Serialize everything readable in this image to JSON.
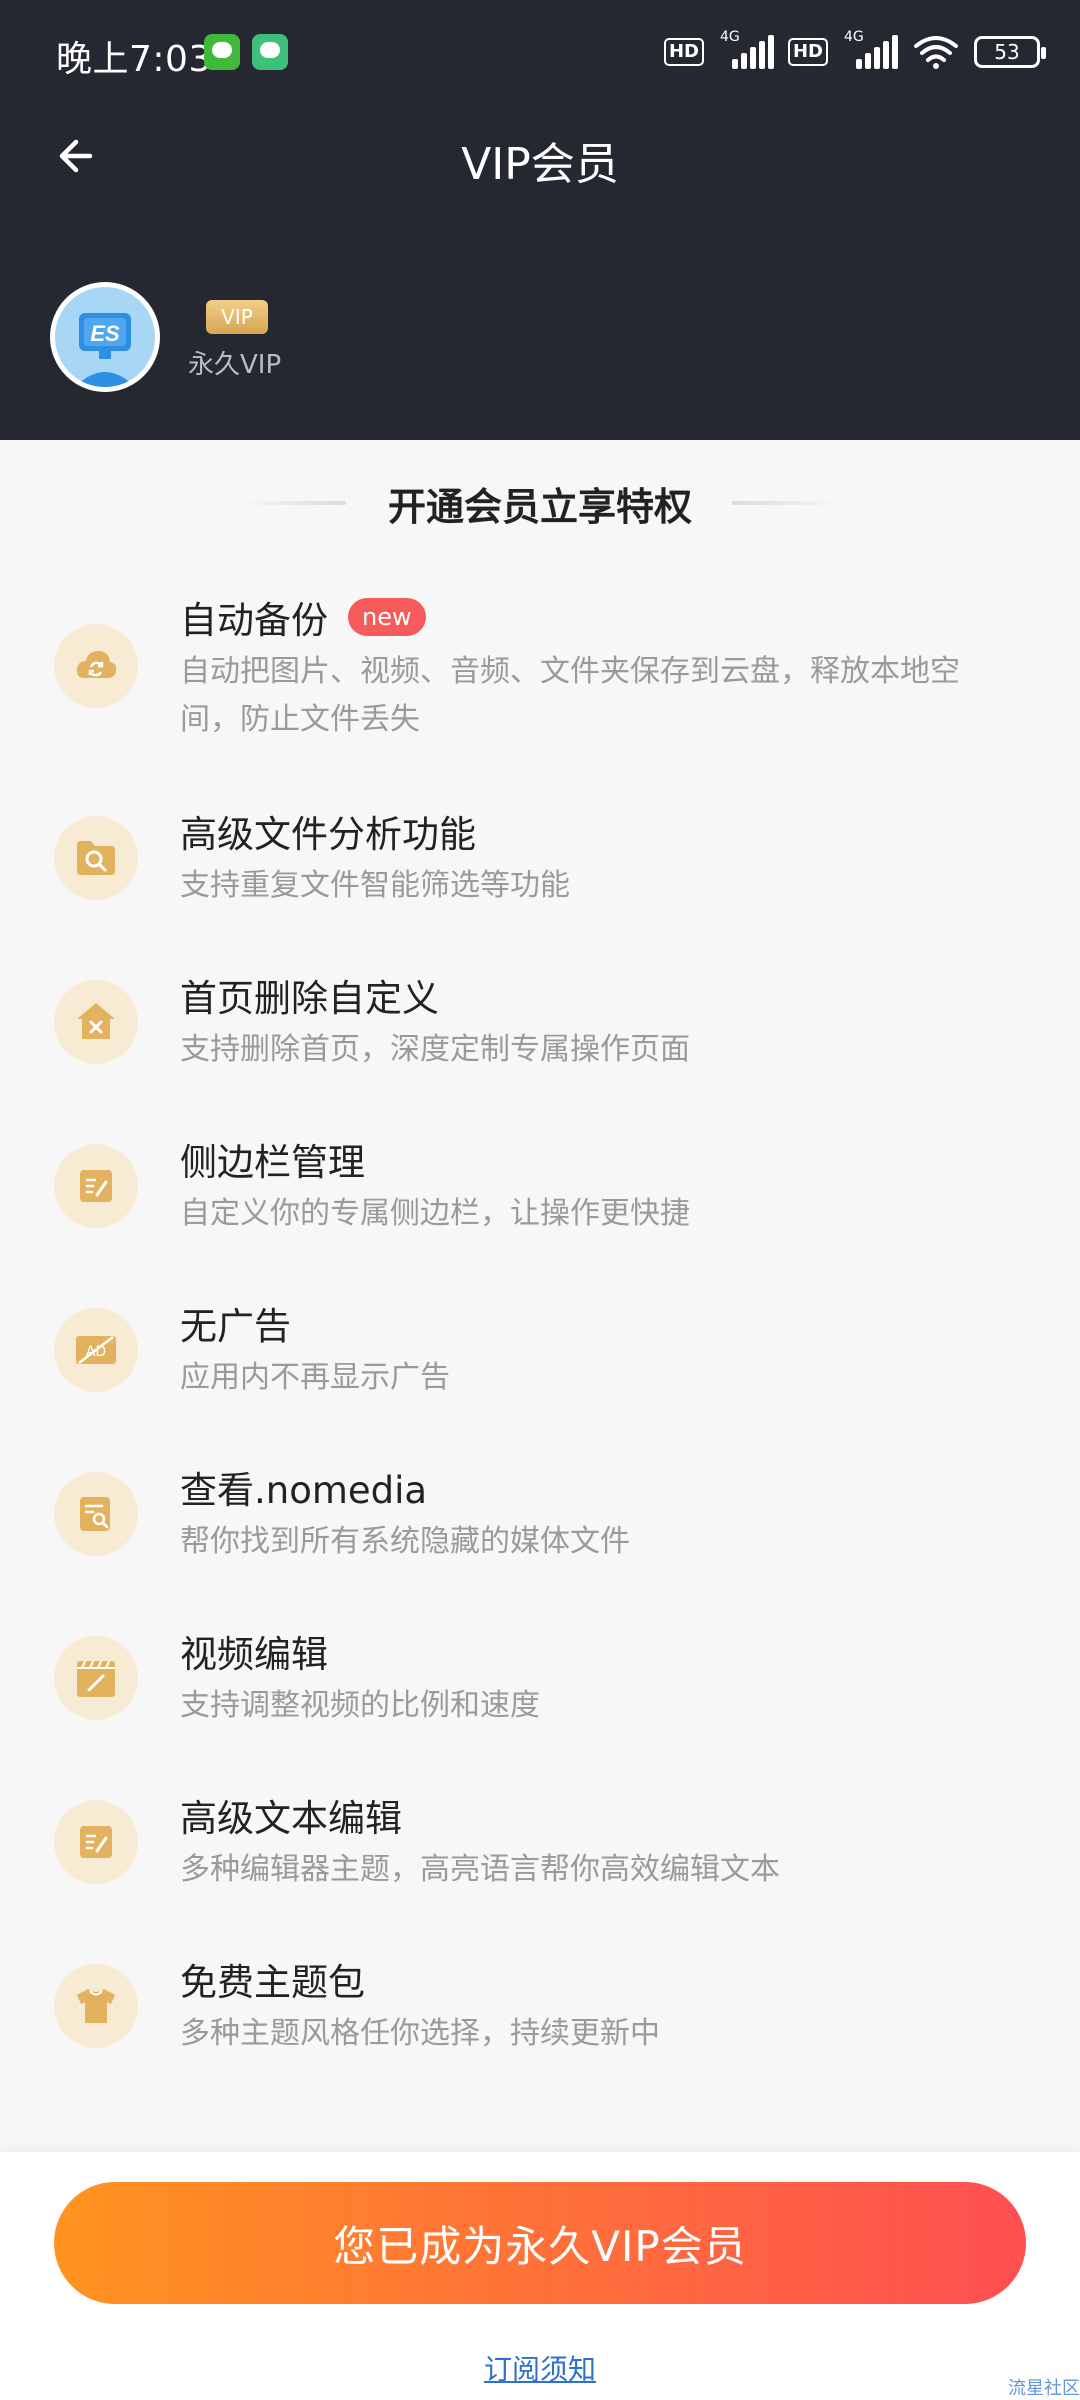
{
  "status_bar": {
    "time": "晚上7:03",
    "hd1": "HD",
    "net1": "4G",
    "hd2": "HD",
    "net2": "4G",
    "battery": "53"
  },
  "header": {
    "title": "VIP会员",
    "back_icon": "arrow-left-icon"
  },
  "user": {
    "avatar_text": "ES",
    "vip_badge": "VIP",
    "vip_type": "永久VIP"
  },
  "section": {
    "title": "开通会员立享特权"
  },
  "features": [
    {
      "icon": "cloud-sync-icon",
      "title": "自动备份",
      "badge": "new",
      "desc": "自动把图片、视频、音频、文件夹保存到云盘，释放本地空间，防止文件丢失"
    },
    {
      "icon": "folder-search-icon",
      "title": "高级文件分析功能",
      "desc": "支持重复文件智能筛选等功能"
    },
    {
      "icon": "home-delete-icon",
      "title": "首页删除自定义",
      "desc": "支持删除首页，深度定制专属操作页面"
    },
    {
      "icon": "sidebar-edit-icon",
      "title": "侧边栏管理",
      "desc": "自定义你的专属侧边栏，让操作更快捷"
    },
    {
      "icon": "no-ad-icon",
      "title": "无广告",
      "desc": "应用内不再显示广告"
    },
    {
      "icon": "nomedia-search-icon",
      "title": "查看.nomedia",
      "desc": "帮你找到所有系统隐藏的媒体文件"
    },
    {
      "icon": "video-edit-icon",
      "title": "视频编辑",
      "desc": "支持调整视频的比例和速度"
    },
    {
      "icon": "text-edit-icon",
      "title": "高级文本编辑",
      "desc": "多种编辑器主题，高亮语言帮你高效编辑文本"
    },
    {
      "icon": "tshirt-theme-icon",
      "title": "免费主题包",
      "desc": "多种主题风格任你选择，持续更新中"
    }
  ],
  "bottom": {
    "cta_label": "您已成为永久VIP会员",
    "notice_link": "订阅须知",
    "watermark": "流星社区"
  },
  "colors": {
    "header_bg": "#252830",
    "accent_start": "#ff931f",
    "accent_end": "#ff4f52",
    "icon_circle": "#f8ebd4",
    "icon_fg": "#e3b25f",
    "new_badge": "#f65a5a"
  }
}
